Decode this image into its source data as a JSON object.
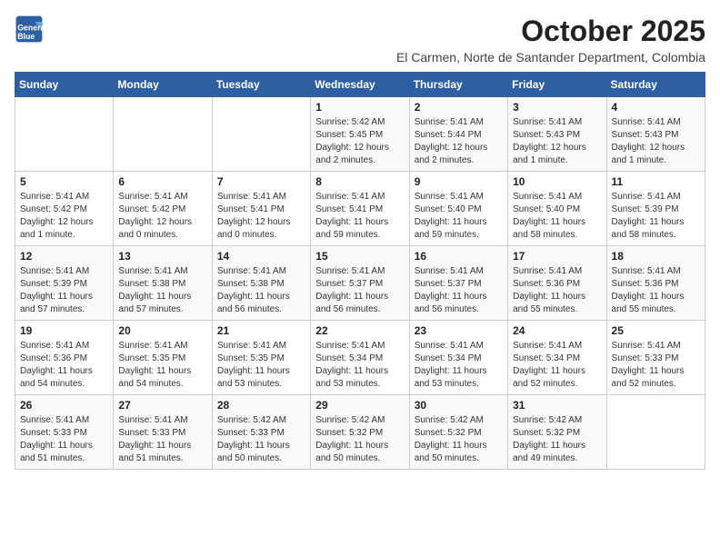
{
  "logo": {
    "line1": "General",
    "line2": "Blue"
  },
  "title": "October 2025",
  "subtitle": "El Carmen, Norte de Santander Department, Colombia",
  "days_of_week": [
    "Sunday",
    "Monday",
    "Tuesday",
    "Wednesday",
    "Thursday",
    "Friday",
    "Saturday"
  ],
  "weeks": [
    [
      {
        "day": "",
        "info": ""
      },
      {
        "day": "",
        "info": ""
      },
      {
        "day": "",
        "info": ""
      },
      {
        "day": "1",
        "info": "Sunrise: 5:42 AM\nSunset: 5:45 PM\nDaylight: 12 hours and 2 minutes."
      },
      {
        "day": "2",
        "info": "Sunrise: 5:41 AM\nSunset: 5:44 PM\nDaylight: 12 hours and 2 minutes."
      },
      {
        "day": "3",
        "info": "Sunrise: 5:41 AM\nSunset: 5:43 PM\nDaylight: 12 hours and 1 minute."
      },
      {
        "day": "4",
        "info": "Sunrise: 5:41 AM\nSunset: 5:43 PM\nDaylight: 12 hours and 1 minute."
      }
    ],
    [
      {
        "day": "5",
        "info": "Sunrise: 5:41 AM\nSunset: 5:42 PM\nDaylight: 12 hours and 1 minute."
      },
      {
        "day": "6",
        "info": "Sunrise: 5:41 AM\nSunset: 5:42 PM\nDaylight: 12 hours and 0 minutes."
      },
      {
        "day": "7",
        "info": "Sunrise: 5:41 AM\nSunset: 5:41 PM\nDaylight: 12 hours and 0 minutes."
      },
      {
        "day": "8",
        "info": "Sunrise: 5:41 AM\nSunset: 5:41 PM\nDaylight: 11 hours and 59 minutes."
      },
      {
        "day": "9",
        "info": "Sunrise: 5:41 AM\nSunset: 5:40 PM\nDaylight: 11 hours and 59 minutes."
      },
      {
        "day": "10",
        "info": "Sunrise: 5:41 AM\nSunset: 5:40 PM\nDaylight: 11 hours and 58 minutes."
      },
      {
        "day": "11",
        "info": "Sunrise: 5:41 AM\nSunset: 5:39 PM\nDaylight: 11 hours and 58 minutes."
      }
    ],
    [
      {
        "day": "12",
        "info": "Sunrise: 5:41 AM\nSunset: 5:39 PM\nDaylight: 11 hours and 57 minutes."
      },
      {
        "day": "13",
        "info": "Sunrise: 5:41 AM\nSunset: 5:38 PM\nDaylight: 11 hours and 57 minutes."
      },
      {
        "day": "14",
        "info": "Sunrise: 5:41 AM\nSunset: 5:38 PM\nDaylight: 11 hours and 56 minutes."
      },
      {
        "day": "15",
        "info": "Sunrise: 5:41 AM\nSunset: 5:37 PM\nDaylight: 11 hours and 56 minutes."
      },
      {
        "day": "16",
        "info": "Sunrise: 5:41 AM\nSunset: 5:37 PM\nDaylight: 11 hours and 56 minutes."
      },
      {
        "day": "17",
        "info": "Sunrise: 5:41 AM\nSunset: 5:36 PM\nDaylight: 11 hours and 55 minutes."
      },
      {
        "day": "18",
        "info": "Sunrise: 5:41 AM\nSunset: 5:36 PM\nDaylight: 11 hours and 55 minutes."
      }
    ],
    [
      {
        "day": "19",
        "info": "Sunrise: 5:41 AM\nSunset: 5:36 PM\nDaylight: 11 hours and 54 minutes."
      },
      {
        "day": "20",
        "info": "Sunrise: 5:41 AM\nSunset: 5:35 PM\nDaylight: 11 hours and 54 minutes."
      },
      {
        "day": "21",
        "info": "Sunrise: 5:41 AM\nSunset: 5:35 PM\nDaylight: 11 hours and 53 minutes."
      },
      {
        "day": "22",
        "info": "Sunrise: 5:41 AM\nSunset: 5:34 PM\nDaylight: 11 hours and 53 minutes."
      },
      {
        "day": "23",
        "info": "Sunrise: 5:41 AM\nSunset: 5:34 PM\nDaylight: 11 hours and 53 minutes."
      },
      {
        "day": "24",
        "info": "Sunrise: 5:41 AM\nSunset: 5:34 PM\nDaylight: 11 hours and 52 minutes."
      },
      {
        "day": "25",
        "info": "Sunrise: 5:41 AM\nSunset: 5:33 PM\nDaylight: 11 hours and 52 minutes."
      }
    ],
    [
      {
        "day": "26",
        "info": "Sunrise: 5:41 AM\nSunset: 5:33 PM\nDaylight: 11 hours and 51 minutes."
      },
      {
        "day": "27",
        "info": "Sunrise: 5:41 AM\nSunset: 5:33 PM\nDaylight: 11 hours and 51 minutes."
      },
      {
        "day": "28",
        "info": "Sunrise: 5:42 AM\nSunset: 5:33 PM\nDaylight: 11 hours and 50 minutes."
      },
      {
        "day": "29",
        "info": "Sunrise: 5:42 AM\nSunset: 5:32 PM\nDaylight: 11 hours and 50 minutes."
      },
      {
        "day": "30",
        "info": "Sunrise: 5:42 AM\nSunset: 5:32 PM\nDaylight: 11 hours and 50 minutes."
      },
      {
        "day": "31",
        "info": "Sunrise: 5:42 AM\nSunset: 5:32 PM\nDaylight: 11 hours and 49 minutes."
      },
      {
        "day": "",
        "info": ""
      }
    ]
  ]
}
